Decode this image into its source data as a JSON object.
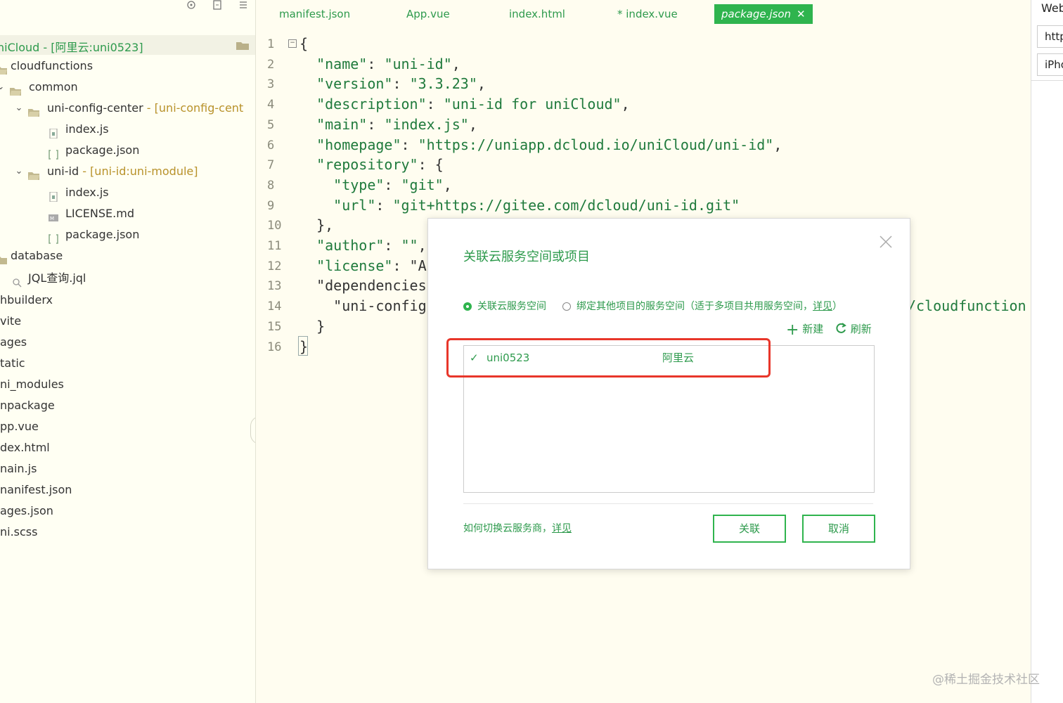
{
  "sidebar": {
    "project_label": "niCloud - [阿里云:uni0523]",
    "items": [
      {
        "label": "cloudfunctions",
        "tag": ""
      },
      {
        "label": "common",
        "tag": ""
      },
      {
        "label": "uni-config-center",
        "tag": " - [uni-config-cent"
      },
      {
        "label": "index.js",
        "tag": ""
      },
      {
        "label": "package.json",
        "tag": ""
      },
      {
        "label": "uni-id",
        "tag": " - [uni-id:uni-module]"
      },
      {
        "label": "index.js",
        "tag": ""
      },
      {
        "label": "LICENSE.md",
        "tag": ""
      },
      {
        "label": "package.json",
        "tag": ""
      },
      {
        "label": "database",
        "tag": ""
      },
      {
        "label": "JQL查询.jql",
        "tag": ""
      },
      {
        "label": "hbuilderx",
        "tag": ""
      },
      {
        "label": "vite",
        "tag": ""
      },
      {
        "label": "ages",
        "tag": ""
      },
      {
        "label": "tatic",
        "tag": ""
      },
      {
        "label": "ni_modules",
        "tag": ""
      },
      {
        "label": "npackage",
        "tag": ""
      },
      {
        "label": "pp.vue",
        "tag": ""
      },
      {
        "label": "dex.html",
        "tag": ""
      },
      {
        "label": "nain.js",
        "tag": ""
      },
      {
        "label": "nanifest.json",
        "tag": ""
      },
      {
        "label": "ages.json",
        "tag": ""
      },
      {
        "label": "ni.scss",
        "tag": ""
      }
    ]
  },
  "tabs": [
    {
      "label": "manifest.json"
    },
    {
      "label": "App.vue"
    },
    {
      "label": "index.html"
    },
    {
      "label": "* index.vue"
    },
    {
      "label": "package.json",
      "close": "✕"
    }
  ],
  "editor": {
    "lines": [
      {
        "n": "1",
        "code": "{"
      },
      {
        "n": "2",
        "code": "  \"name\": \"uni-id\","
      },
      {
        "n": "3",
        "code": "  \"version\": \"3.3.23\","
      },
      {
        "n": "4",
        "code": "  \"description\": \"uni-id for uniCloud\","
      },
      {
        "n": "5",
        "code": "  \"main\": \"index.js\","
      },
      {
        "n": "6",
        "code": "  \"homepage\": \"https://uniapp.dcloud.io/uniCloud/uni-id\","
      },
      {
        "n": "7",
        "code": "  \"repository\": {"
      },
      {
        "n": "8",
        "code": "    \"type\": \"git\","
      },
      {
        "n": "9",
        "code": "    \"url\": \"git+https://gitee.com/dcloud/uni-id.git\""
      },
      {
        "n": "10",
        "code": "  },"
      },
      {
        "n": "11",
        "code": "  \"author\": \"\","
      },
      {
        "n": "12",
        "code": "  \"license\": \"A"
      },
      {
        "n": "13",
        "code": "  \"dependencies"
      },
      {
        "n": "14",
        "code": "    \"uni-config"
      },
      {
        "n": "15",
        "code": "  }"
      },
      {
        "n": "16",
        "code": "}"
      }
    ],
    "line14_trailing": "/cloudfunction"
  },
  "right_panel": {
    "title": "Web",
    "field1": "http",
    "field2": "iPho"
  },
  "dialog": {
    "title": "关联云服务空间或项目",
    "radio_option_1": "关联云服务空间",
    "radio_option_2": "绑定其他项目的服务空间（适于多项目共用服务空间，",
    "radio_option_2_link": "详见",
    "radio_option_2_end": "）",
    "new_label": "新建",
    "refresh_label": "刷新",
    "list_item": {
      "check": "✓",
      "name": "uni0523",
      "provider": "阿里云"
    },
    "help_text": "如何切换云服务商，",
    "help_link": "详见",
    "confirm_label": "关联",
    "cancel_label": "取消"
  },
  "watermark": "@稀土掘金技术社区",
  "colors": {
    "accent": "#2fb44e",
    "highlight": "#e8362a"
  }
}
